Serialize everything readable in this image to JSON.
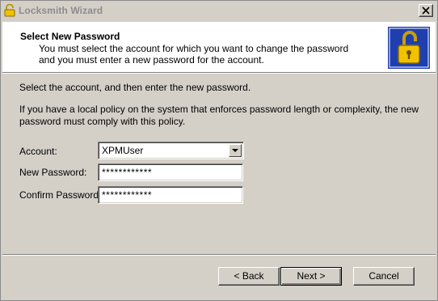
{
  "window": {
    "title": "Locksmith Wizard",
    "close_symbol": "×"
  },
  "header": {
    "title": "Select New Password",
    "description": "You must select the account for which you want to change the password and you must enter a new password for the account.",
    "icon": "padlock-open-icon"
  },
  "body": {
    "intro": "Select the account, and then enter the new password.",
    "policy_note": "If you have a local policy on the system that enforces password length or complexity, the new password must comply with this policy.",
    "account_label": "Account:",
    "account_value": "XPMUser",
    "new_password_label": "New Password:",
    "new_password_value": "************",
    "confirm_password_label": "Confirm Password:",
    "confirm_password_value": "************"
  },
  "buttons": {
    "back": "< Back",
    "next": "Next >",
    "cancel": "Cancel"
  },
  "colors": {
    "window_bg": "#d4d0c8",
    "header_bg": "#ffffff",
    "icon_bg": "#1f3fb0",
    "lock_gold": "#f2c200"
  }
}
